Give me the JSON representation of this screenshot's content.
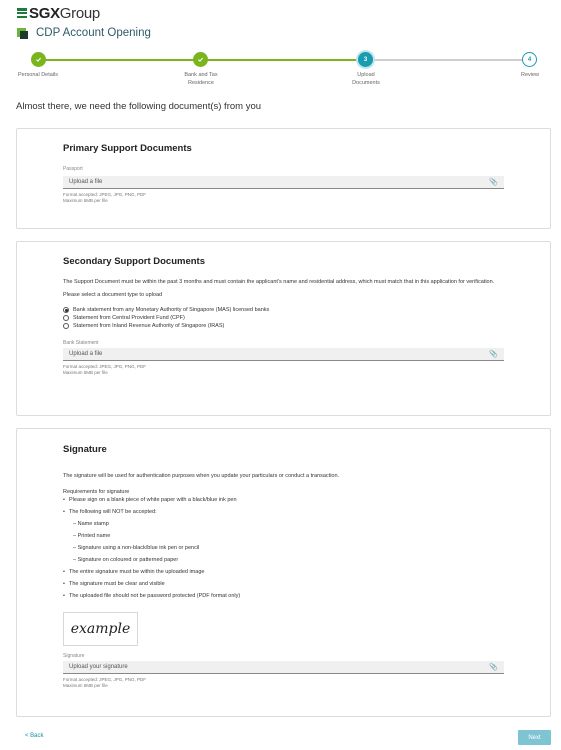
{
  "brand": {
    "name_bold": "SGX",
    "name_rest": "Group"
  },
  "app": {
    "title": "CDP Account Opening"
  },
  "stepper": {
    "steps": [
      {
        "label": "Personal Details",
        "state": "done",
        "number": "1"
      },
      {
        "label": "Bank and Tax Residence",
        "state": "done",
        "number": "2"
      },
      {
        "label": "Upload Documents",
        "state": "current",
        "number": "3"
      },
      {
        "label": "Review",
        "state": "todo",
        "number": "4"
      }
    ],
    "colors": {
      "done": "#7ab51d",
      "current": "#1a9bb0",
      "pending_line": "#cfcfcf"
    }
  },
  "intro": "Almost there, we need the following document(s) from you",
  "primary": {
    "title": "Primary Support Documents",
    "field_label": "Passport",
    "upload_placeholder": "Upload a file",
    "note_formats": "Format accepted: JPEG, JPG, PNG, PDF",
    "note_size": "Maximum 5MB per file"
  },
  "secondary": {
    "title": "Secondary Support Documents",
    "description": "The Support Document must be within the past 3 months and must contain the applicant's name and residential address, which must match that in this application for verification.",
    "select_prompt": "Please select a document type to upload",
    "options": [
      {
        "label": "Bank statement from any Monetary Authority of Singapore (MAS) licensed banks",
        "selected": true
      },
      {
        "label": "Statement from Central Provident Fund (CPF)",
        "selected": false
      },
      {
        "label": "Statement from Inland Revenue Authority of Singapore (IRAS)",
        "selected": false
      }
    ],
    "field_label": "Bank Statement",
    "upload_placeholder": "Upload a file",
    "note_formats": "Format accepted: JPEG, JPG, PNG, PDF",
    "note_size": "Maximum 5MB per file"
  },
  "signature": {
    "title": "Signature",
    "description": "The signature will be used for authentication purposes when you update your particulars or conduct a transaction.",
    "requirements_heading": "Requirements for signature",
    "req_1": "Please sign on a blank piece of white paper with a black/blue ink pen",
    "req_2": "The following will NOT be accepted:",
    "not_accepted": [
      "Name stamp",
      "Printed name",
      "Signature using a non-black/blue ink pen or pencil",
      "Signature on coloured or patterned paper"
    ],
    "req_3": "The entire signature must be within the uploaded image",
    "req_4": "The signature must be clear and visible",
    "req_5": "The uploaded file should not be password protected (PDF format only)",
    "example_text": "example",
    "field_label": "Signature",
    "upload_placeholder": "Upload your signature",
    "note_formats": "Format accepted: JPEG, JPG, PNG, PDF",
    "note_size": "Maximum 5MB per file"
  },
  "footer": {
    "back_label": "< Back",
    "next_label": "Next"
  }
}
